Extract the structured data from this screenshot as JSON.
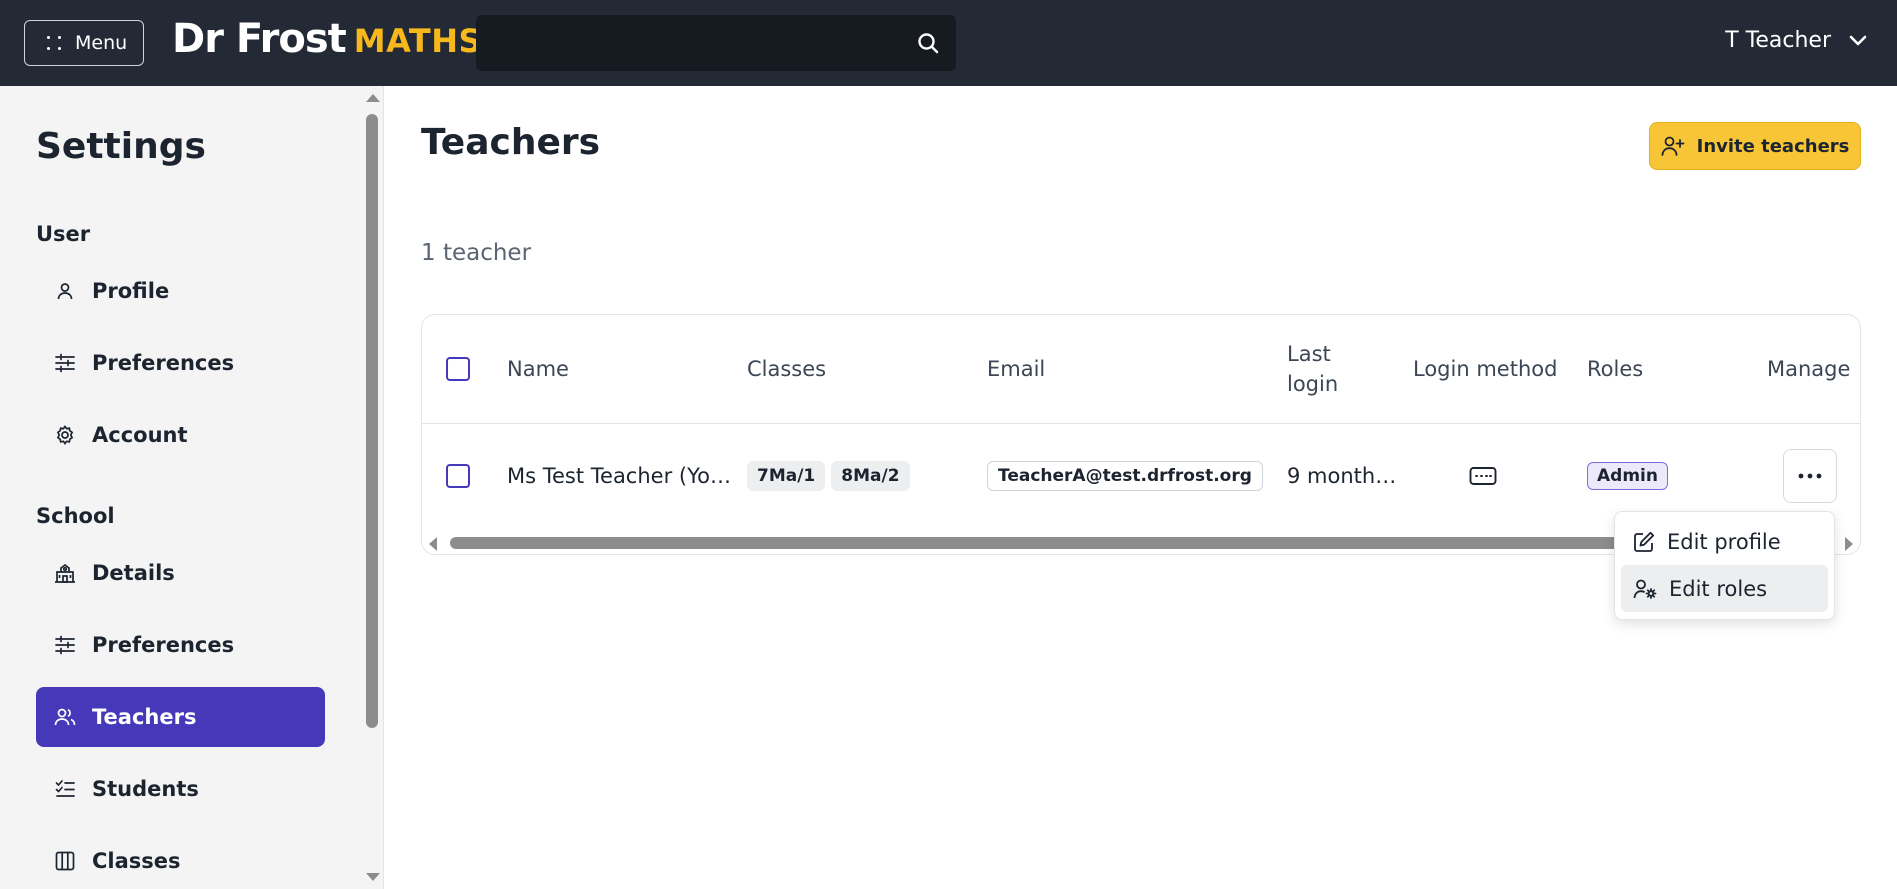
{
  "header": {
    "menu_label": "Menu",
    "logo_text": "Dr Frost",
    "logo_subtext": "MATHS",
    "search_placeholder": "",
    "user_name": "T Teacher"
  },
  "sidebar": {
    "title": "Settings",
    "sections": [
      {
        "label": "User",
        "items": [
          {
            "label": "Profile",
            "icon": "person-icon"
          },
          {
            "label": "Preferences",
            "icon": "sliders-icon"
          },
          {
            "label": "Account",
            "icon": "gear-icon"
          }
        ]
      },
      {
        "label": "School",
        "items": [
          {
            "label": "Details",
            "icon": "school-building-icon"
          },
          {
            "label": "Preferences",
            "icon": "sliders-icon"
          },
          {
            "label": "Teachers",
            "icon": "people-icon",
            "active": true
          },
          {
            "label": "Students",
            "icon": "checklist-icon"
          },
          {
            "label": "Classes",
            "icon": "columns-icon"
          }
        ]
      }
    ]
  },
  "main": {
    "title": "Teachers",
    "invite_label": "Invite teachers",
    "count_text": "1 teacher",
    "table": {
      "columns": [
        "Name",
        "Classes",
        "Email",
        "Last login",
        "Login method",
        "Roles",
        "Manage"
      ],
      "rows": [
        {
          "name": "Ms Test Teacher (Yo…",
          "classes": [
            "7Ma/1",
            "8Ma/2"
          ],
          "email": "TeacherA@test.drfrost.org",
          "last_login": "9 month…",
          "login_method_icon": "keyboard-icon",
          "role": "Admin"
        }
      ]
    },
    "manage_menu": {
      "items": [
        {
          "label": "Edit profile",
          "icon": "edit-icon"
        },
        {
          "label": "Edit roles",
          "icon": "user-settings-icon",
          "hover": true
        }
      ]
    }
  },
  "colors": {
    "topbar": "#232a35",
    "accent": "#4539b9",
    "brand_yellow": "#f6b81a",
    "invite_button": "#f8c536"
  }
}
